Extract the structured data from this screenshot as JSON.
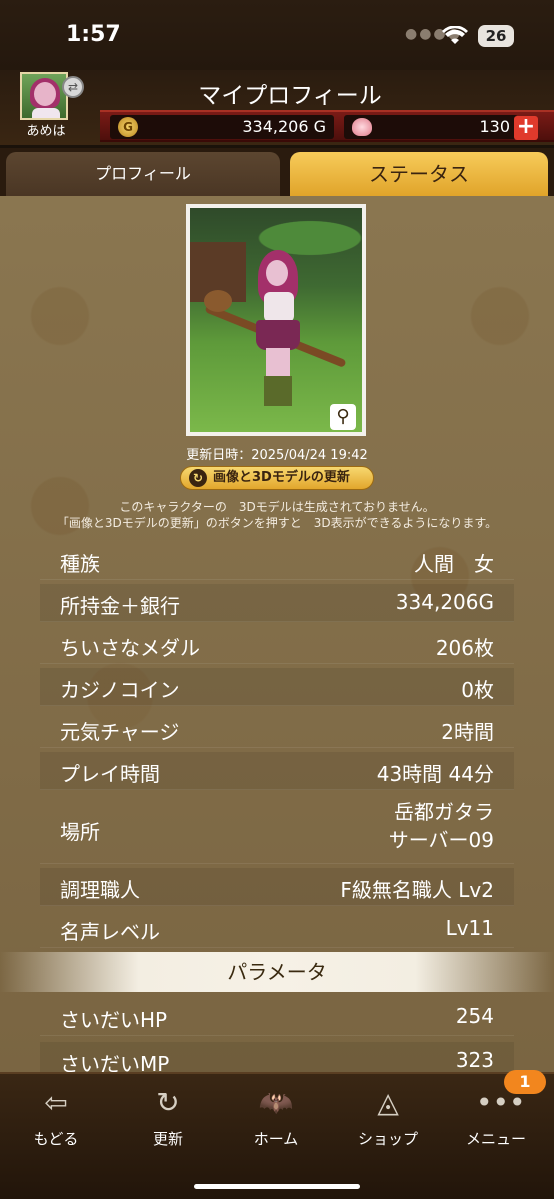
{
  "status_bar": {
    "time": "1:57",
    "battery": "26"
  },
  "header": {
    "title": "マイプロフィール",
    "player_name": "あめは",
    "gold": "334,206 G",
    "gems": "130",
    "add_label": "+"
  },
  "tabs": [
    {
      "label": "プロフィール",
      "active": false
    },
    {
      "label": "ステータス",
      "active": true
    }
  ],
  "portrait": {
    "updated": "更新日時：2025/04/24  19:42",
    "update_button": "画像と3Dモデルの更新",
    "notice_line1": "このキャラクターの　3Dモデルは生成されておりません。",
    "notice_line2": "「画像と3Dモデルの更新」のボタンを押すと　3D表示ができるようになります。"
  },
  "stats": [
    {
      "label": "種族",
      "value": "人間　女"
    },
    {
      "label": "所持金＋銀行",
      "value": "334,206G"
    },
    {
      "label": "ちいさなメダル",
      "value": "206枚"
    },
    {
      "label": "カジノコイン",
      "value": "0枚"
    },
    {
      "label": "元気チャージ",
      "value": "2時間"
    },
    {
      "label": "プレイ時間",
      "value": "43時間 44分"
    },
    {
      "label": "場所",
      "value_line1": "岳都ガタラ",
      "value_line2": "サーバー09"
    },
    {
      "label": "調理職人",
      "value": "F級無名職人 Lv2"
    },
    {
      "label": "名声レベル",
      "value": "Lv11"
    }
  ],
  "parameters_header": "パラメータ",
  "parameters": [
    {
      "label": "さいだいHP",
      "value": "254"
    },
    {
      "label": "さいだいMP",
      "value": "323"
    }
  ],
  "bottom_nav": [
    {
      "label": "もどる",
      "icon": "back-arrow-icon"
    },
    {
      "label": "更新",
      "icon": "refresh-icon"
    },
    {
      "label": "ホーム",
      "icon": "dracky-home-icon"
    },
    {
      "label": "ショップ",
      "icon": "slime-shop-icon"
    },
    {
      "label": "メニュー",
      "icon": "more-dots-icon",
      "badge": "1"
    }
  ],
  "colors": {
    "accent": "#e0a42a",
    "header_bar": "#7a1b16",
    "badge": "#f2861e"
  }
}
